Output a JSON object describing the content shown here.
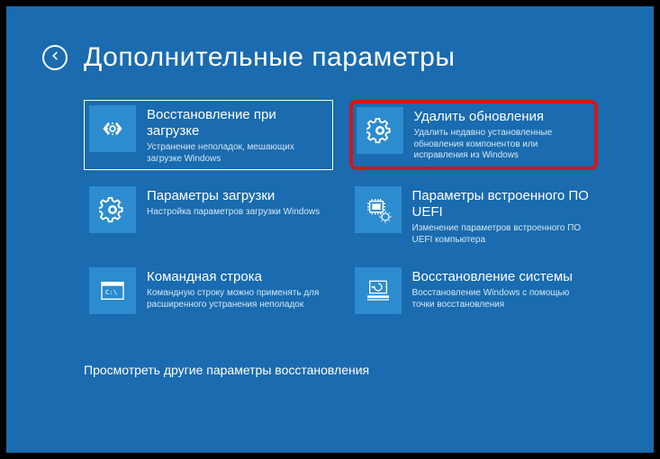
{
  "title": "Дополнительные параметры",
  "tiles": [
    {
      "title": "Восстановление при загрузке",
      "desc": "Устранение неполадок, мешающих загрузке Windows"
    },
    {
      "title": "Удалить обновления",
      "desc": "Удалить недавно установленные обновления компонентов или исправления из Windows"
    },
    {
      "title": "Параметры загрузки",
      "desc": "Настройка параметров загрузки Windows"
    },
    {
      "title": "Параметры встроенного ПО UEFI",
      "desc": "Изменение параметров встроенного ПО UEFI компьютера"
    },
    {
      "title": "Командная строка",
      "desc": "Командную строку можно применять для расширенного устранения неполадок"
    },
    {
      "title": "Восстановление системы",
      "desc": "Восстановление Windows с помощью точки восстановления"
    }
  ],
  "footer": "Просмотреть другие параметры восстановления"
}
